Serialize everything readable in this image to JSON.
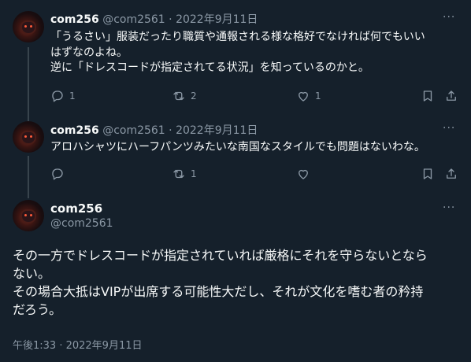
{
  "tweets": [
    {
      "name": "com256",
      "handle": "@com2561",
      "separator": "·",
      "date": "2022年9月11日",
      "more": "···",
      "lines": [
        "「うるさい」服装だったり職質や通報される様な格好でなければ何でもいい",
        "はずなのよね。",
        "逆に「ドレスコードが指定されてる状況」を知っているのかと。"
      ],
      "replies": "1",
      "retweets": "2",
      "likes": "1"
    },
    {
      "name": "com256",
      "handle": "@com2561",
      "separator": "·",
      "date": "2022年9月11日",
      "more": "···",
      "lines": [
        "アロハシャツにハーフパンツみたいな南国なスタイルでも問題はないわな。"
      ],
      "replies": "",
      "retweets": "1",
      "likes": ""
    }
  ],
  "main": {
    "name": "com256",
    "handle": "@com2561",
    "more": "···",
    "lines": [
      "その一方でドレスコードが指定されていれば厳格にそれを守らないとなら",
      "ない。",
      "その場合大抵はVIPが出席する可能性大だし、それが文化を嗜む者の矜持",
      "だろう。"
    ],
    "meta": "午後1:33 · 2022年9月11日"
  },
  "icons": [
    "reply-icon",
    "retweet-icon",
    "like-icon",
    "bookmark-icon",
    "share-icon",
    "more-icon"
  ],
  "colors": {
    "background": "#15202b",
    "text": "#f7f9f9",
    "secondary": "#8b98a5",
    "thread_line": "#38444d"
  }
}
